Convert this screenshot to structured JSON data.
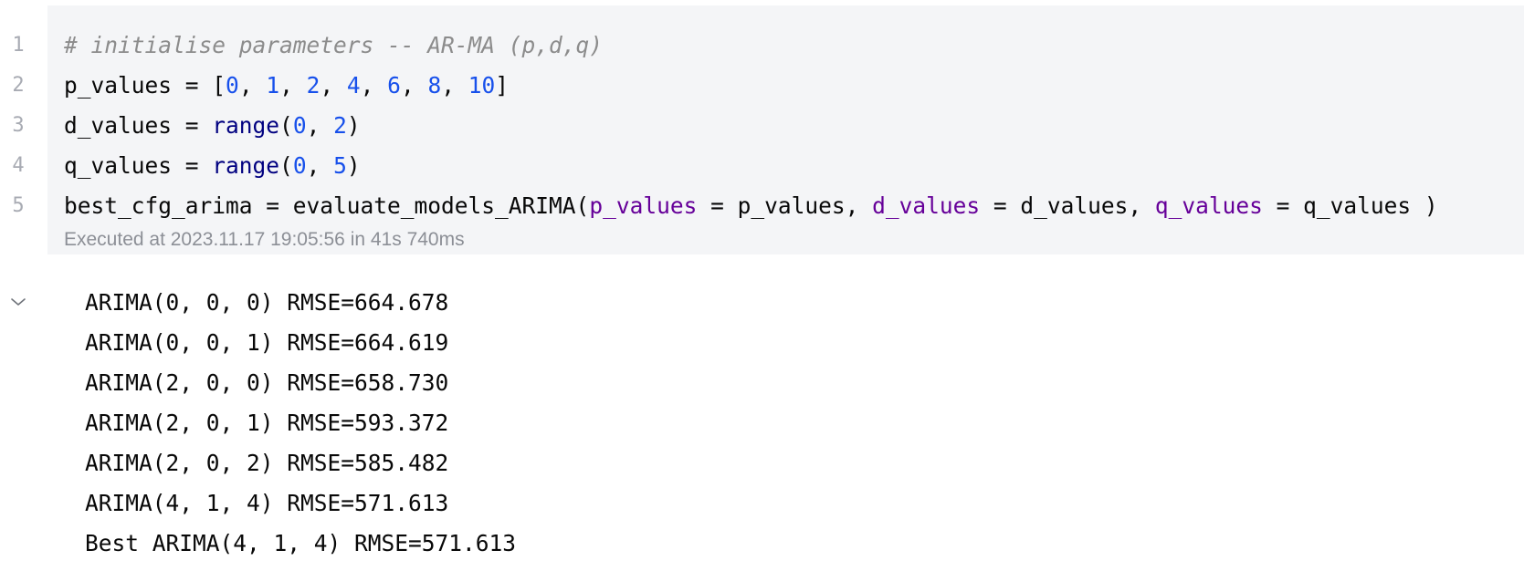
{
  "cell": {
    "line_numbers": [
      "1",
      "2",
      "3",
      "4",
      "5"
    ],
    "line1": {
      "comment": "# initialise parameters -- AR-MA (p,d,q)"
    },
    "line2": {
      "var": "p_values",
      "eq": " = ",
      "open": "[",
      "n0": "0",
      "n1": "1",
      "n2": "2",
      "n3": "4",
      "n4": "6",
      "n5": "8",
      "n6": "10",
      "sep": ", ",
      "close": "]"
    },
    "line3": {
      "var": "d_values",
      "eq": " = ",
      "fn": "range",
      "open": "(",
      "a": "0",
      "sep": ", ",
      "b": "2",
      "close": ")"
    },
    "line4": {
      "var": "q_values",
      "eq": " = ",
      "fn": "range",
      "open": "(",
      "a": "0",
      "sep": ", ",
      "b": "5",
      "close": ")"
    },
    "line5": {
      "var": "best_cfg_arima",
      "eq": " = ",
      "fn": "evaluate_models_ARIMA",
      "open": "(",
      "k1": "p_values",
      "v1": " = p_values, ",
      "k2": "d_values",
      "v2": " = d_values, ",
      "k3": "q_values",
      "v3": " = q_values )"
    },
    "execution_info": "Executed at 2023.11.17 19:05:56 in 41s 740ms"
  },
  "output": {
    "collapse_icon": "chevron-down-icon",
    "lines": [
      "ARIMA(0, 0, 0) RMSE=664.678",
      "ARIMA(0, 0, 1) RMSE=664.619",
      "ARIMA(2, 0, 0) RMSE=658.730",
      "ARIMA(2, 0, 1) RMSE=593.372",
      "ARIMA(2, 0, 2) RMSE=585.482",
      "ARIMA(4, 1, 4) RMSE=571.613",
      "Best ARIMA(4, 1, 4) RMSE=571.613"
    ]
  },
  "colors": {
    "code_background": "#f4f5f7",
    "number": "#1750eb",
    "builtin": "#000080",
    "keyword_argument": "#660099",
    "comment": "#8c8c8c",
    "line_number": "#a8abb3"
  }
}
